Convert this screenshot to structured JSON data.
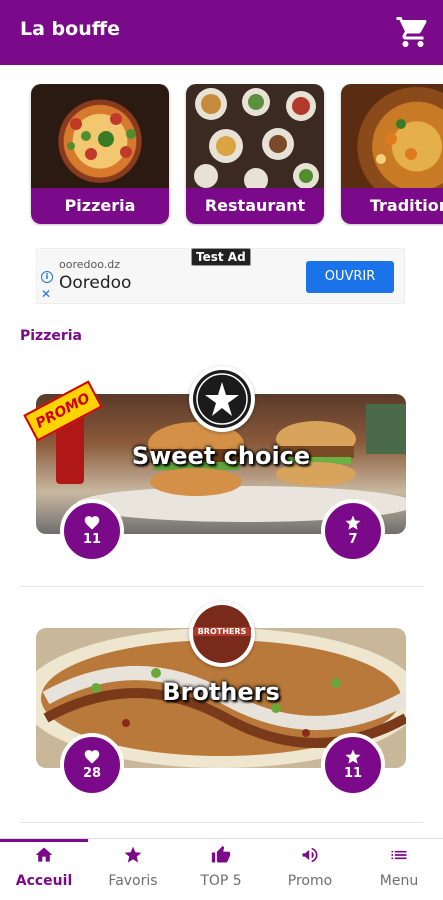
{
  "header": {
    "title": "La bouffe",
    "cart_icon": "cart-icon"
  },
  "categories": [
    {
      "label": "Pizzeria"
    },
    {
      "label": "Restaurant"
    },
    {
      "label": "Tradition"
    }
  ],
  "ad": {
    "tag": "Test Ad",
    "domain": "ooredoo.dz",
    "brand": "Ooredoo",
    "cta": "OUVRIR",
    "info_icon": "info-icon",
    "close_icon": "close-icon"
  },
  "section": {
    "title": "Pizzeria"
  },
  "restaurants": [
    {
      "name": "Sweet choice",
      "likes": "11",
      "rating": "7",
      "badge": "PROMO"
    },
    {
      "name": "Brothers",
      "likes": "28",
      "rating": "11",
      "logo_text": "BROTHERS"
    }
  ],
  "nav": [
    {
      "label": "Acceuil",
      "icon": "home-icon",
      "active": true
    },
    {
      "label": "Favoris",
      "icon": "star-icon",
      "active": false
    },
    {
      "label": "TOP 5",
      "icon": "thumbs-up-icon",
      "active": false
    },
    {
      "label": "Promo",
      "icon": "megaphone-icon",
      "active": false
    },
    {
      "label": "Menu",
      "icon": "list-icon",
      "active": false
    }
  ],
  "colors": {
    "brand": "#7b0a8a",
    "ad_button": "#1a73e8",
    "promo_yellow": "#ffd400"
  }
}
